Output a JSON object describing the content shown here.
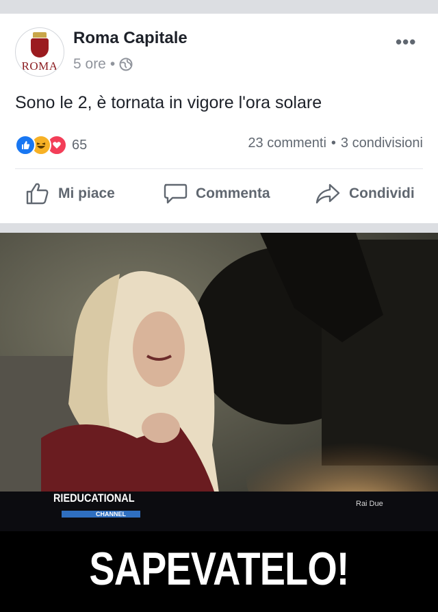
{
  "post": {
    "page_name": "Roma Capitale",
    "avatar_text": "ROMA",
    "time": "5 ore",
    "separator": "•",
    "text": "Sono le 2, è tornata in vigore l'ora solare",
    "reaction_count": "65",
    "comments": "23 commenti",
    "stats_separator": "•",
    "shares": "3 condivisioni"
  },
  "actions": {
    "like": "Mi piace",
    "comment": "Commenta",
    "share": "Condividi"
  },
  "image": {
    "logo_line1": "RIEDUCATIONAL",
    "logo_line2": "CHANNEL",
    "channel": "Rai Due",
    "caption": "SAPEVATELO!"
  },
  "colors": {
    "name": "#1d2129",
    "meta": "#90949c",
    "like_blue": "#1877f2",
    "love_red": "#f33e58",
    "haha_yellow": "#f7b125"
  },
  "icons": [
    "more-icon",
    "globe-icon",
    "like-reaction-icon",
    "haha-reaction-icon",
    "love-reaction-icon",
    "thumbs-up-icon",
    "comment-icon",
    "share-icon"
  ]
}
